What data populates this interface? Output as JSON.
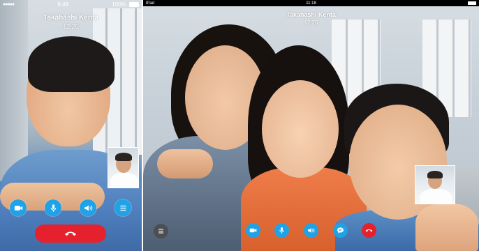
{
  "phone": {
    "status": {
      "signal": "●●●●●",
      "time": "9:49",
      "battery": "100%"
    },
    "caller": {
      "name": "Takahashi Kenta",
      "duration": "12:20"
    },
    "controls": [
      {
        "name": "video-button",
        "icon": "video-camera-icon"
      },
      {
        "name": "mute-button",
        "icon": "microphone-icon"
      },
      {
        "name": "speaker-button",
        "icon": "speaker-icon"
      },
      {
        "name": "menu-button",
        "icon": "menu-icon"
      }
    ],
    "end_call": {
      "icon": "hang-up-icon"
    }
  },
  "tablet": {
    "status": {
      "device": "iPad",
      "time": "11:18"
    },
    "caller": {
      "name": "Takahashi Kenta",
      "duration": "12:20"
    },
    "controls": [
      {
        "name": "menu-button",
        "icon": "menu-icon"
      },
      {
        "name": "video-button",
        "icon": "video-camera-icon"
      },
      {
        "name": "mute-button",
        "icon": "microphone-icon"
      },
      {
        "name": "speaker-button",
        "icon": "speaker-icon"
      },
      {
        "name": "chat-button",
        "icon": "chat-bubble-icon"
      },
      {
        "name": "end-call-button",
        "icon": "hang-up-icon"
      }
    ]
  },
  "colors": {
    "accent": "#1fa2e6",
    "end_call": "#e5212d"
  }
}
